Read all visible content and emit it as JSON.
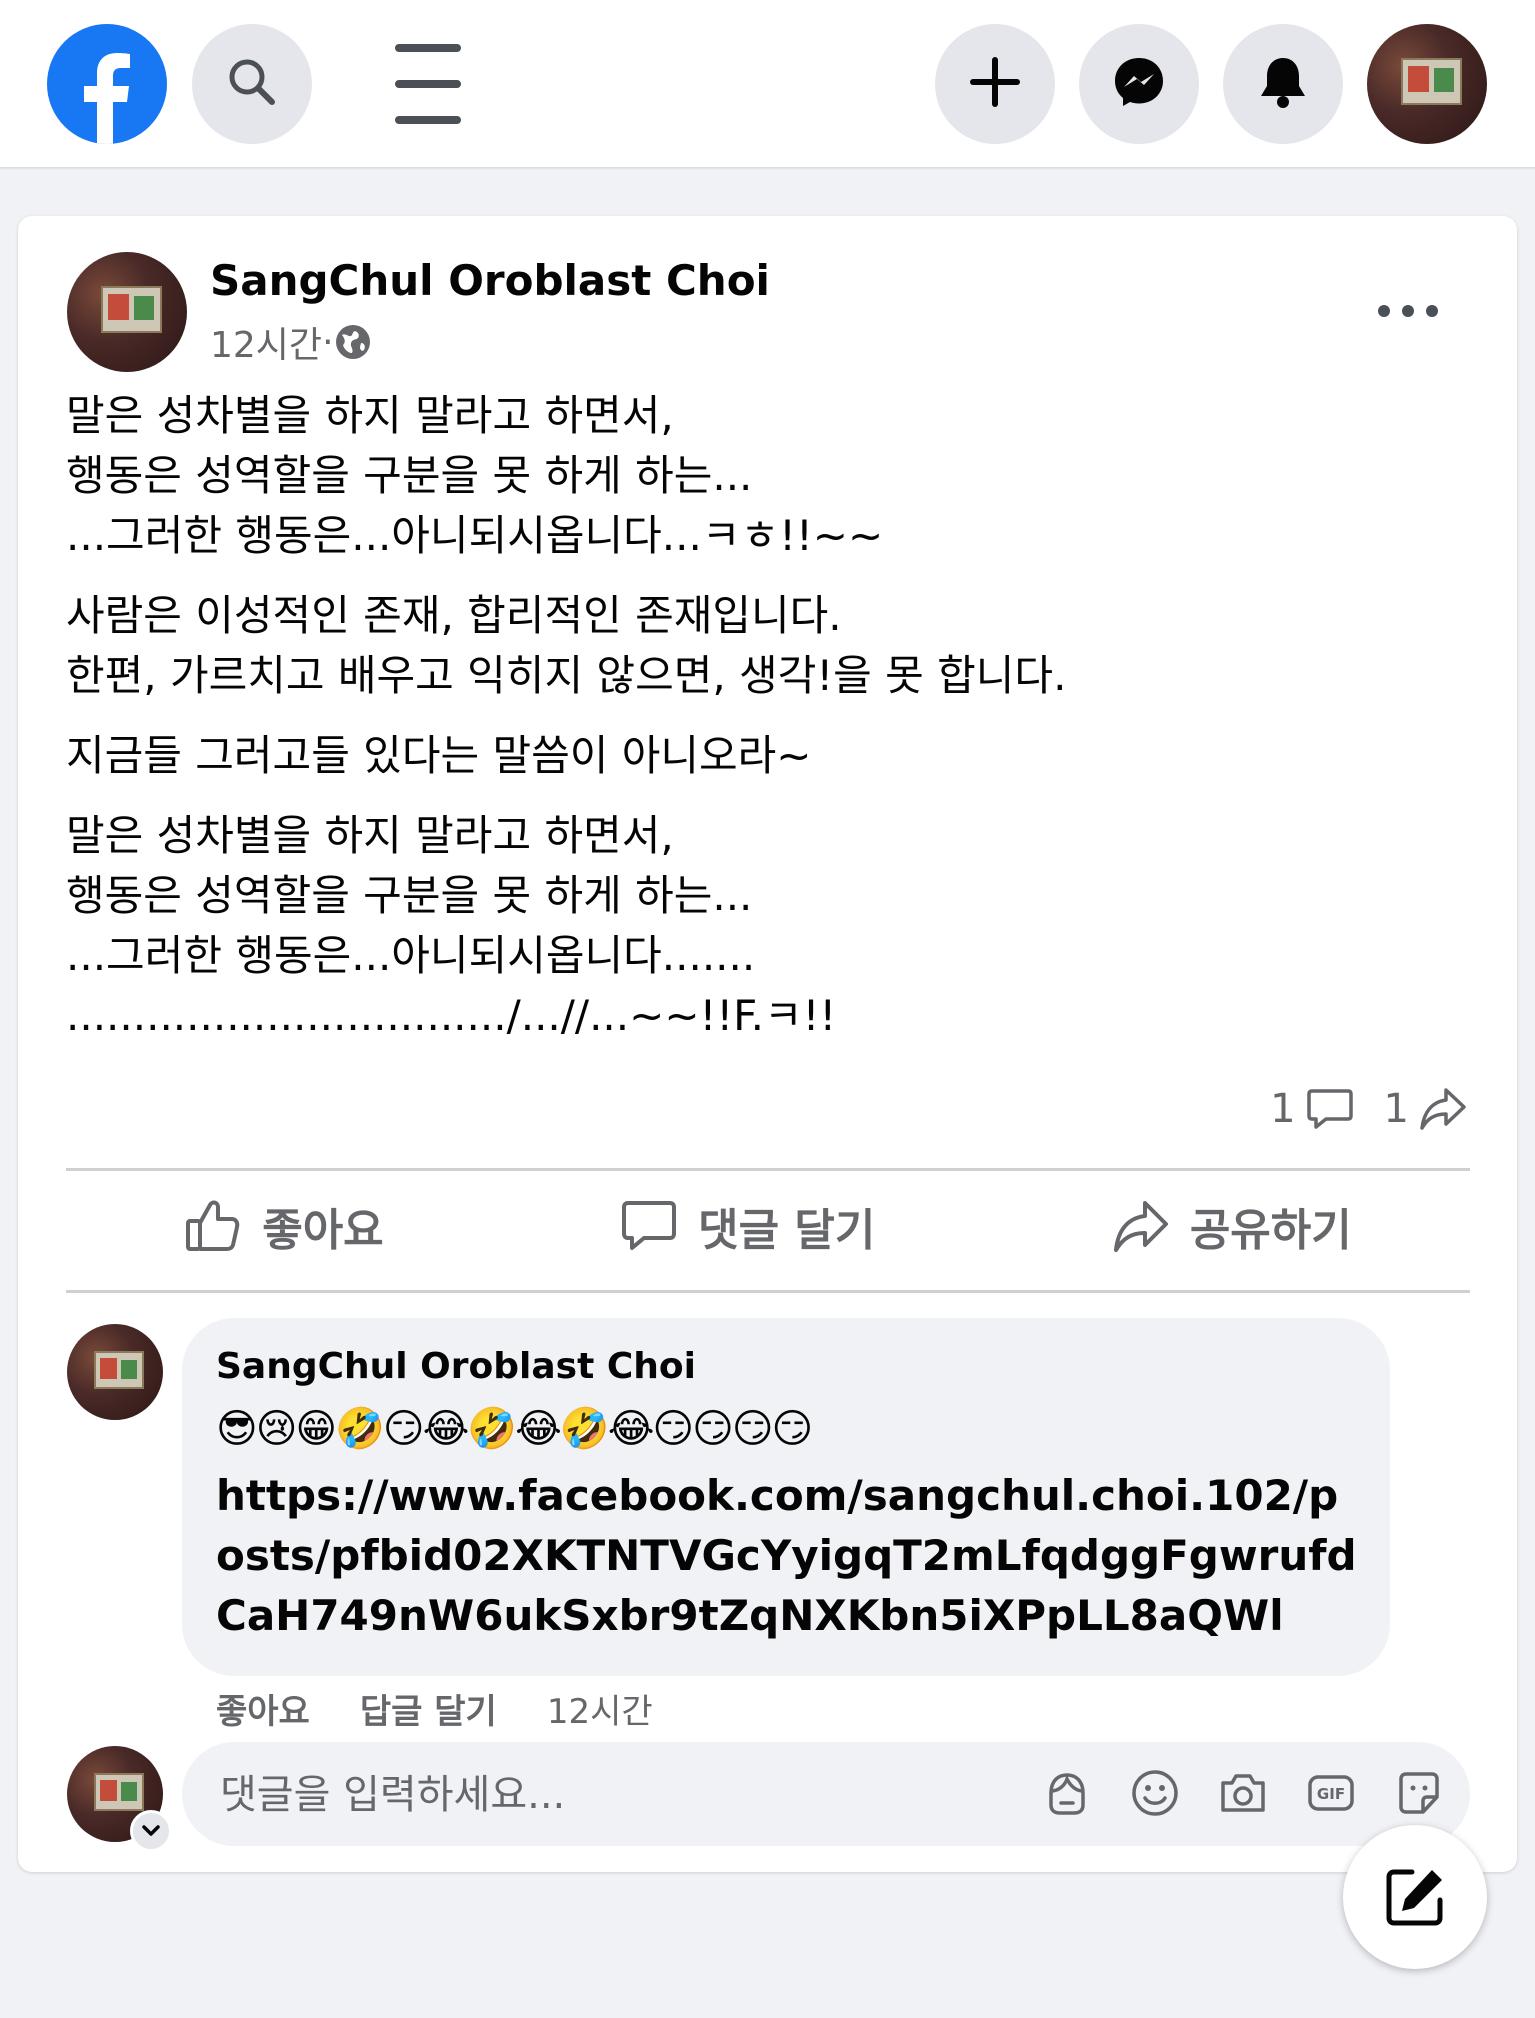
{
  "colors": {
    "brand": "#1877f2",
    "secondary_text": "#65676b",
    "page_bg": "#f0f2f5",
    "button_bg": "#e4e6eb"
  },
  "header": {
    "logo_icon": "facebook-logo-icon",
    "search_icon": "search-icon",
    "menu_icon": "hamburger-menu-icon",
    "create_icon": "plus-icon",
    "messenger_icon": "messenger-icon",
    "notifications_icon": "bell-icon",
    "profile_icon": "avatar"
  },
  "post": {
    "author": "SangChul Oroblast Choi",
    "time": "12시간",
    "separator": " · ",
    "privacy_icon": "globe-icon",
    "more_icon": "more-options-icon",
    "paragraphs": [
      "말은 성차별을 하지 말라고 하면서,\n행동은 성역할을 구분을 못 하게 하는...\n...그러한 행동은...아니되시옵니다...ㅋㅎ!!~~",
      "사람은 이성적인 존재, 합리적인 존재입니다.\n한편, 가르치고 배우고 익히지 않으면, 생각!을 못 합니다.",
      "지금들 그러고들 있다는 말씀이 아니오라~",
      "말은 성차별을 하지 말라고 하면서,\n행동은 성역할을 구분을 못 하게 하는...\n...그러한 행동은...아니되시옵니다.......\n................................./...//...~~!!F.ㅋ!!"
    ],
    "comment_count": "1",
    "share_count": "1"
  },
  "actions": {
    "like": "좋아요",
    "comment": "댓글 달기",
    "share": "공유하기"
  },
  "comment": {
    "author": "SangChul Oroblast Choi",
    "emojis": "😎😢😁🤣😏😂🤣😂🤣😂😏😏😏😏",
    "link": "https://www.facebook.com/sangchul.choi.102/posts/pfbid02XKTNTVGcYyigqT2mLfqdggFgwrufdCaH749nW6ukSxbr9tZqNXKbn5iXPpLL8aQWl",
    "like": "좋아요",
    "reply": "답글 달기",
    "time": "12시간"
  },
  "composer": {
    "placeholder": "댓글을 입력하세요...",
    "icons": [
      "avatar-sticker-icon",
      "emoji-icon",
      "camera-icon",
      "gif-icon",
      "sticker-icon"
    ]
  },
  "fab_icon": "compose-icon"
}
